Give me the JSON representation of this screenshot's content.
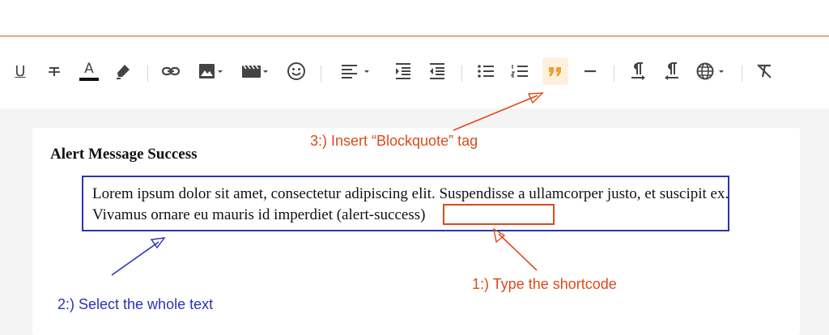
{
  "toolbar": {
    "buttons": [
      {
        "name": "underline",
        "icon": "underline-icon",
        "glyph": "U"
      },
      {
        "name": "strikethrough",
        "icon": "strikethrough-icon"
      },
      {
        "name": "font-color",
        "icon": "font-color-icon",
        "glyph": "A"
      },
      {
        "name": "highlight",
        "icon": "highlighter-icon"
      },
      {
        "name": "link",
        "icon": "link-icon"
      },
      {
        "name": "image",
        "icon": "image-icon"
      },
      {
        "name": "video",
        "icon": "video-icon"
      },
      {
        "name": "emoji",
        "icon": "smiley-icon"
      },
      {
        "name": "align",
        "icon": "align-left-icon"
      },
      {
        "name": "indent",
        "icon": "indent-icon"
      },
      {
        "name": "outdent",
        "icon": "outdent-icon"
      },
      {
        "name": "bullet-list",
        "icon": "bullet-list-icon"
      },
      {
        "name": "numbered-list",
        "icon": "numbered-list-icon"
      },
      {
        "name": "blockquote",
        "icon": "quote-icon",
        "active": true
      },
      {
        "name": "horizontal-rule",
        "icon": "horizontal-rule-icon"
      },
      {
        "name": "ltr",
        "icon": "paragraph-ltr-icon"
      },
      {
        "name": "rtl",
        "icon": "paragraph-rtl-icon"
      },
      {
        "name": "language",
        "icon": "globe-icon"
      },
      {
        "name": "clear-format",
        "icon": "clear-format-icon"
      }
    ],
    "active_color": "#f0a030"
  },
  "editor": {
    "heading": "Alert Message Success",
    "paragraph": "Lorem ipsum dolor sit amet, consectetur adipiscing elit. Suspendisse a ullamcorper justo, et suscipit ex. Vivamus ornare eu mauris id imperdiet ",
    "shortcode": "(alert-success)"
  },
  "annotations": {
    "step3": "3:) Insert “Blockquote” tag",
    "step2": "2:) Select the whole text",
    "step1": "1:) Type the shortcode",
    "colors": {
      "orange": "#dd4a1b",
      "blue": "#2a34b3"
    }
  }
}
